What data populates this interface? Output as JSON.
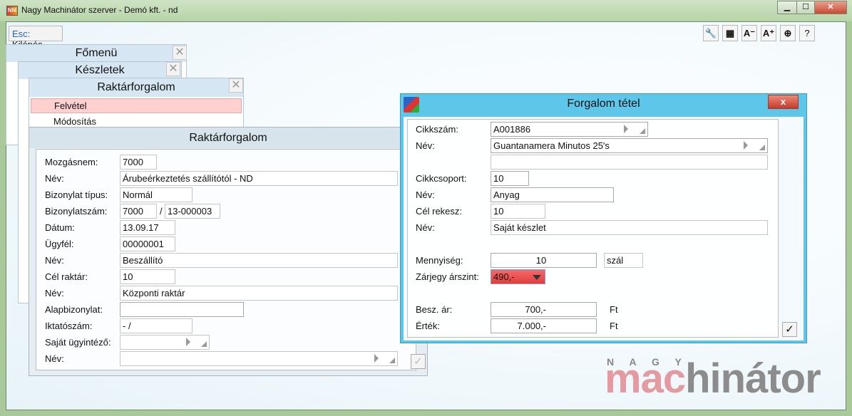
{
  "window": {
    "title": "Nagy Machinátor szerver - Demó kft. - nd",
    "minimize": "▁",
    "maximize": "☐",
    "close": "✕"
  },
  "toolbar": {
    "esc_key": "Esc:",
    "esc_label": "Kilépés",
    "buttons": [
      {
        "icon": "wrench-icon",
        "glyph": "🔧"
      },
      {
        "icon": "grid-icon",
        "glyph": "▦"
      },
      {
        "icon": "font-decrease-icon",
        "glyph": "A⁻"
      },
      {
        "icon": "font-increase-icon",
        "glyph": "A⁺"
      },
      {
        "icon": "navigate-icon",
        "glyph": "⊕"
      },
      {
        "icon": "help-icon",
        "glyph": "?"
      }
    ]
  },
  "panels": {
    "fomenu": "Főmenü",
    "keszletek": "Készletek",
    "raktarforgalom_menu": {
      "title": "Raktárforgalom",
      "items": [
        "Felvétel",
        "Módosítás"
      ]
    },
    "close_glyph": "✕"
  },
  "form": {
    "title": "Raktárforgalom",
    "rows": [
      {
        "label": "Mozgásnem:",
        "value": "7000"
      },
      {
        "label": "Név:",
        "value": "Árubeérkeztetés szállítótól - ND"
      },
      {
        "label": "Bizonylat típus:",
        "value": "Normál"
      },
      {
        "label": "Bizonylatszám:",
        "value": "7000",
        "separator": "/",
        "value2": "13-000003"
      },
      {
        "label": "Dátum:",
        "value": "13.09.17"
      },
      {
        "label": "Ügyfél:",
        "value": "00000001"
      },
      {
        "label": "Név:",
        "value": "Beszállító"
      },
      {
        "label": "Cél raktár:",
        "value": "10"
      },
      {
        "label": "Név:",
        "value": "Központi raktár"
      },
      {
        "label": "Alapbizonylat:",
        "value": ""
      },
      {
        "label": "Iktatószám:",
        "value": "  -  /"
      },
      {
        "label": "Saját ügyintéző:",
        "value": ""
      },
      {
        "label": "Név:",
        "value": ""
      }
    ],
    "ok_glyph": "✓"
  },
  "dialog": {
    "title": "Forgalom tétel",
    "close_glyph": "x",
    "rows": [
      {
        "label": "Cikkszám:",
        "value": "A001886"
      },
      {
        "label": "Név:",
        "value": "Guantanamera Minutos 25's"
      },
      {
        "label": "",
        "value": ""
      },
      {
        "label": "Cikkcsoport:",
        "value": "10"
      },
      {
        "label": "Név:",
        "value": "Anyag"
      },
      {
        "label": "Cél rekesz:",
        "value": "10"
      },
      {
        "label": "Név:",
        "value": "Saját készlet"
      },
      {
        "label": "Mennyiség:",
        "value": "10",
        "unit": "szál"
      },
      {
        "label": "Zárjegy árszint:",
        "value": "490,-"
      },
      {
        "label": "Besz. ár:",
        "value": "700,-",
        "unit": "Ft"
      },
      {
        "label": "Érték:",
        "value": "7.000,-",
        "unit": "Ft"
      }
    ],
    "ok_glyph": "✓"
  },
  "logo": {
    "top": "N A G Y",
    "part1": "mac",
    "part2": "hinátor"
  },
  "colors": {
    "dialog_title": "#5ec6e9",
    "highlight": "#ffd0d0",
    "alert": "#f04848"
  }
}
